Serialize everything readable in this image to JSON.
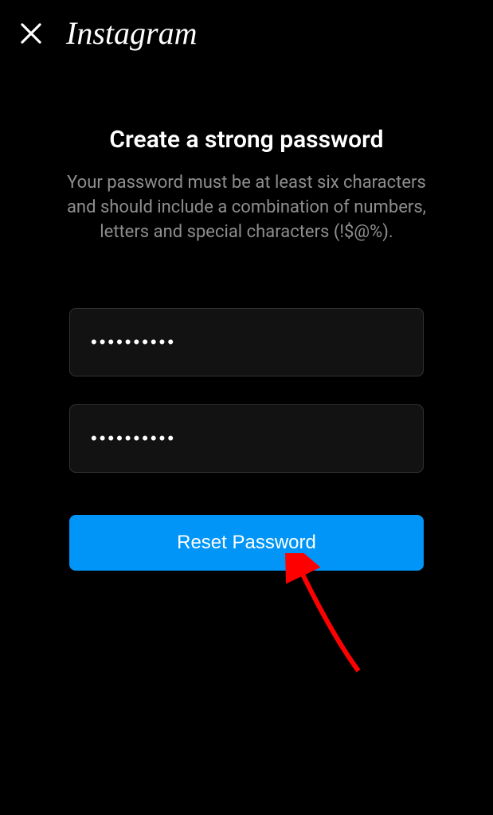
{
  "header": {
    "brand": "Instagram"
  },
  "content": {
    "title": "Create a strong password",
    "description": "Your password must be at least six characters and should include a combination of numbers, letters and special characters (!$@%)."
  },
  "form": {
    "password1_value": "••••••••••",
    "password2_value": "••••••••••",
    "reset_button_label": "Reset Password"
  }
}
